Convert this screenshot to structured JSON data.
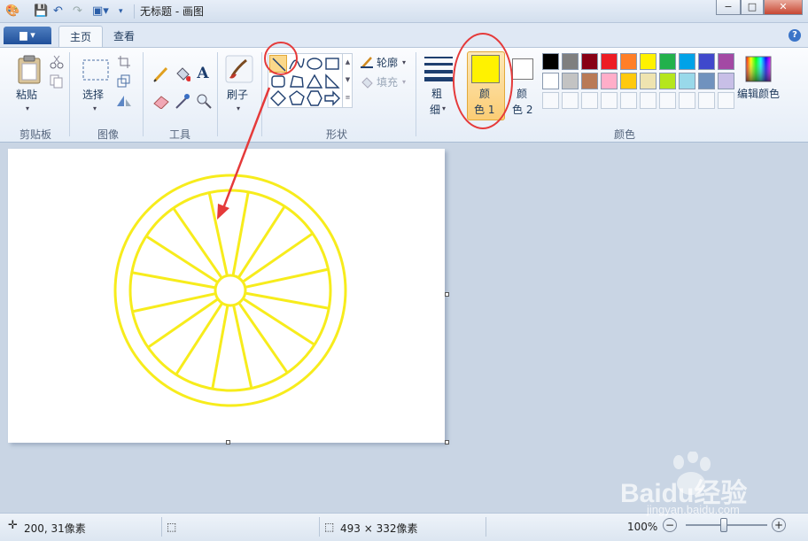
{
  "titlebar": {
    "title": "无标题 - 画图",
    "minimize": "−",
    "maximize": "□",
    "close": "✕"
  },
  "tabs": {
    "app_menu": "▆ ▾",
    "home": "主页",
    "view": "查看",
    "help": "?"
  },
  "clipboard": {
    "paste_label": "粘贴",
    "group": "剪贴板"
  },
  "image": {
    "select_label": "选择",
    "group": "图像"
  },
  "tools": {
    "text_glyph": "A",
    "group": "工具"
  },
  "brushes": {
    "label": "刷子"
  },
  "shapes": {
    "outline_label": "轮廓",
    "fill_label": "填充",
    "group": "形状"
  },
  "size": {
    "label_line1": "粗",
    "label_line2": "细"
  },
  "colors": {
    "color1_line1": "颜",
    "color1_line2": "色 1",
    "color2_line1": "颜",
    "color2_line2": "色 2",
    "edit_colors": "编辑颜色",
    "group": "颜色",
    "color1_value": "#fff200",
    "color2_value": "#ffffff",
    "row1": [
      "#000000",
      "#7f7f7f",
      "#880015",
      "#ed1c24",
      "#ff7f27",
      "#fff200",
      "#22b14c",
      "#00a2e8",
      "#3f48cc",
      "#a349a4"
    ],
    "row2": [
      "#ffffff",
      "#c3c3c3",
      "#b97a57",
      "#ffaec9",
      "#ffc90e",
      "#efe4b0",
      "#b5e61d",
      "#99d9ea",
      "#7092be",
      "#c8bfe7"
    ]
  },
  "canvas": {
    "drawing_color": "#f7ec1c"
  },
  "status": {
    "cursor_pos": "200, 31像素",
    "canvas_size": "493 × 332像素",
    "zoom": "100%"
  },
  "annotation": {
    "color": "#e53a3a"
  },
  "watermark": {
    "brand": "Baidu经验",
    "url": "jingyan.baidu.com"
  }
}
